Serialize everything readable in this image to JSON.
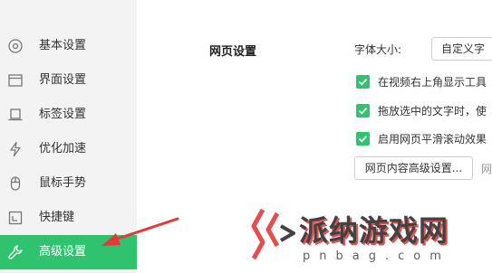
{
  "sidebar": {
    "items": [
      {
        "label": "基本设置",
        "icon": "settings-circle-icon"
      },
      {
        "label": "界面设置",
        "icon": "window-icon"
      },
      {
        "label": "标签设置",
        "icon": "tab-icon"
      },
      {
        "label": "优化加速",
        "icon": "lightning-icon"
      },
      {
        "label": "鼠标手势",
        "icon": "mouse-icon"
      },
      {
        "label": "快捷键",
        "icon": "shortcut-icon"
      },
      {
        "label": "高级设置",
        "icon": "wrench-icon",
        "active": true
      }
    ]
  },
  "main": {
    "section_title": "网页设置",
    "font_size_label": "字体大小:",
    "font_size_value": "自定义字",
    "checkboxes": [
      {
        "text": "在视频右上角显示工具",
        "checked": true
      },
      {
        "text": "拖放选中的文字时，使",
        "checked": true
      },
      {
        "text": "启用网页平滑滚动效果",
        "checked": true
      }
    ],
    "advanced_button": "网页内容高级设置...",
    "hint_text": "网"
  },
  "watermark": {
    "title": "派纳游戏网",
    "subtitle": "pnbag.com"
  },
  "colors": {
    "accent": "#2fc36f",
    "arrow": "#e03a3a",
    "sidebar_bg": "#f3f3f3"
  }
}
